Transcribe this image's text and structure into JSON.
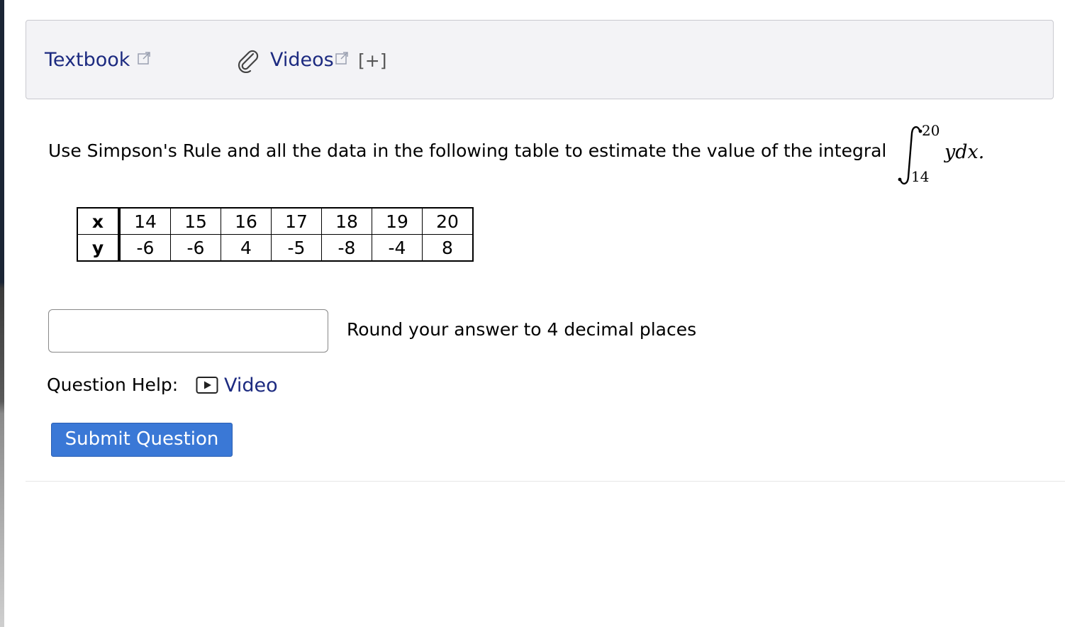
{
  "resources": {
    "textbook_label": "Textbook",
    "videos_label": "Videos",
    "expand_label": "[+]"
  },
  "question": {
    "prompt": "Use Simpson's Rule and all the data in the following table to estimate the value of the integral",
    "integral": {
      "upper": "20",
      "lower": "14",
      "integrand": "ydx."
    },
    "table": {
      "rows": [
        {
          "label": "x",
          "values": [
            "14",
            "15",
            "16",
            "17",
            "18",
            "19",
            "20"
          ]
        },
        {
          "label": "y",
          "values": [
            "-6",
            "-6",
            "4",
            "-5",
            "-8",
            "-4",
            "8"
          ]
        }
      ]
    },
    "answer": {
      "value": "",
      "placeholder": ""
    },
    "round_note": "Round your answer to 4 decimal places",
    "help_label": "Question Help:",
    "help_video_label": "Video",
    "submit_label": "Submit Question"
  },
  "colors": {
    "link": "#1c2a80",
    "submit_bg": "#3a78d6",
    "panel_bg": "#f3f3f6"
  },
  "icons": {
    "external_link": "external-link-icon",
    "attachment": "paperclip-icon",
    "video": "play-video-icon"
  }
}
